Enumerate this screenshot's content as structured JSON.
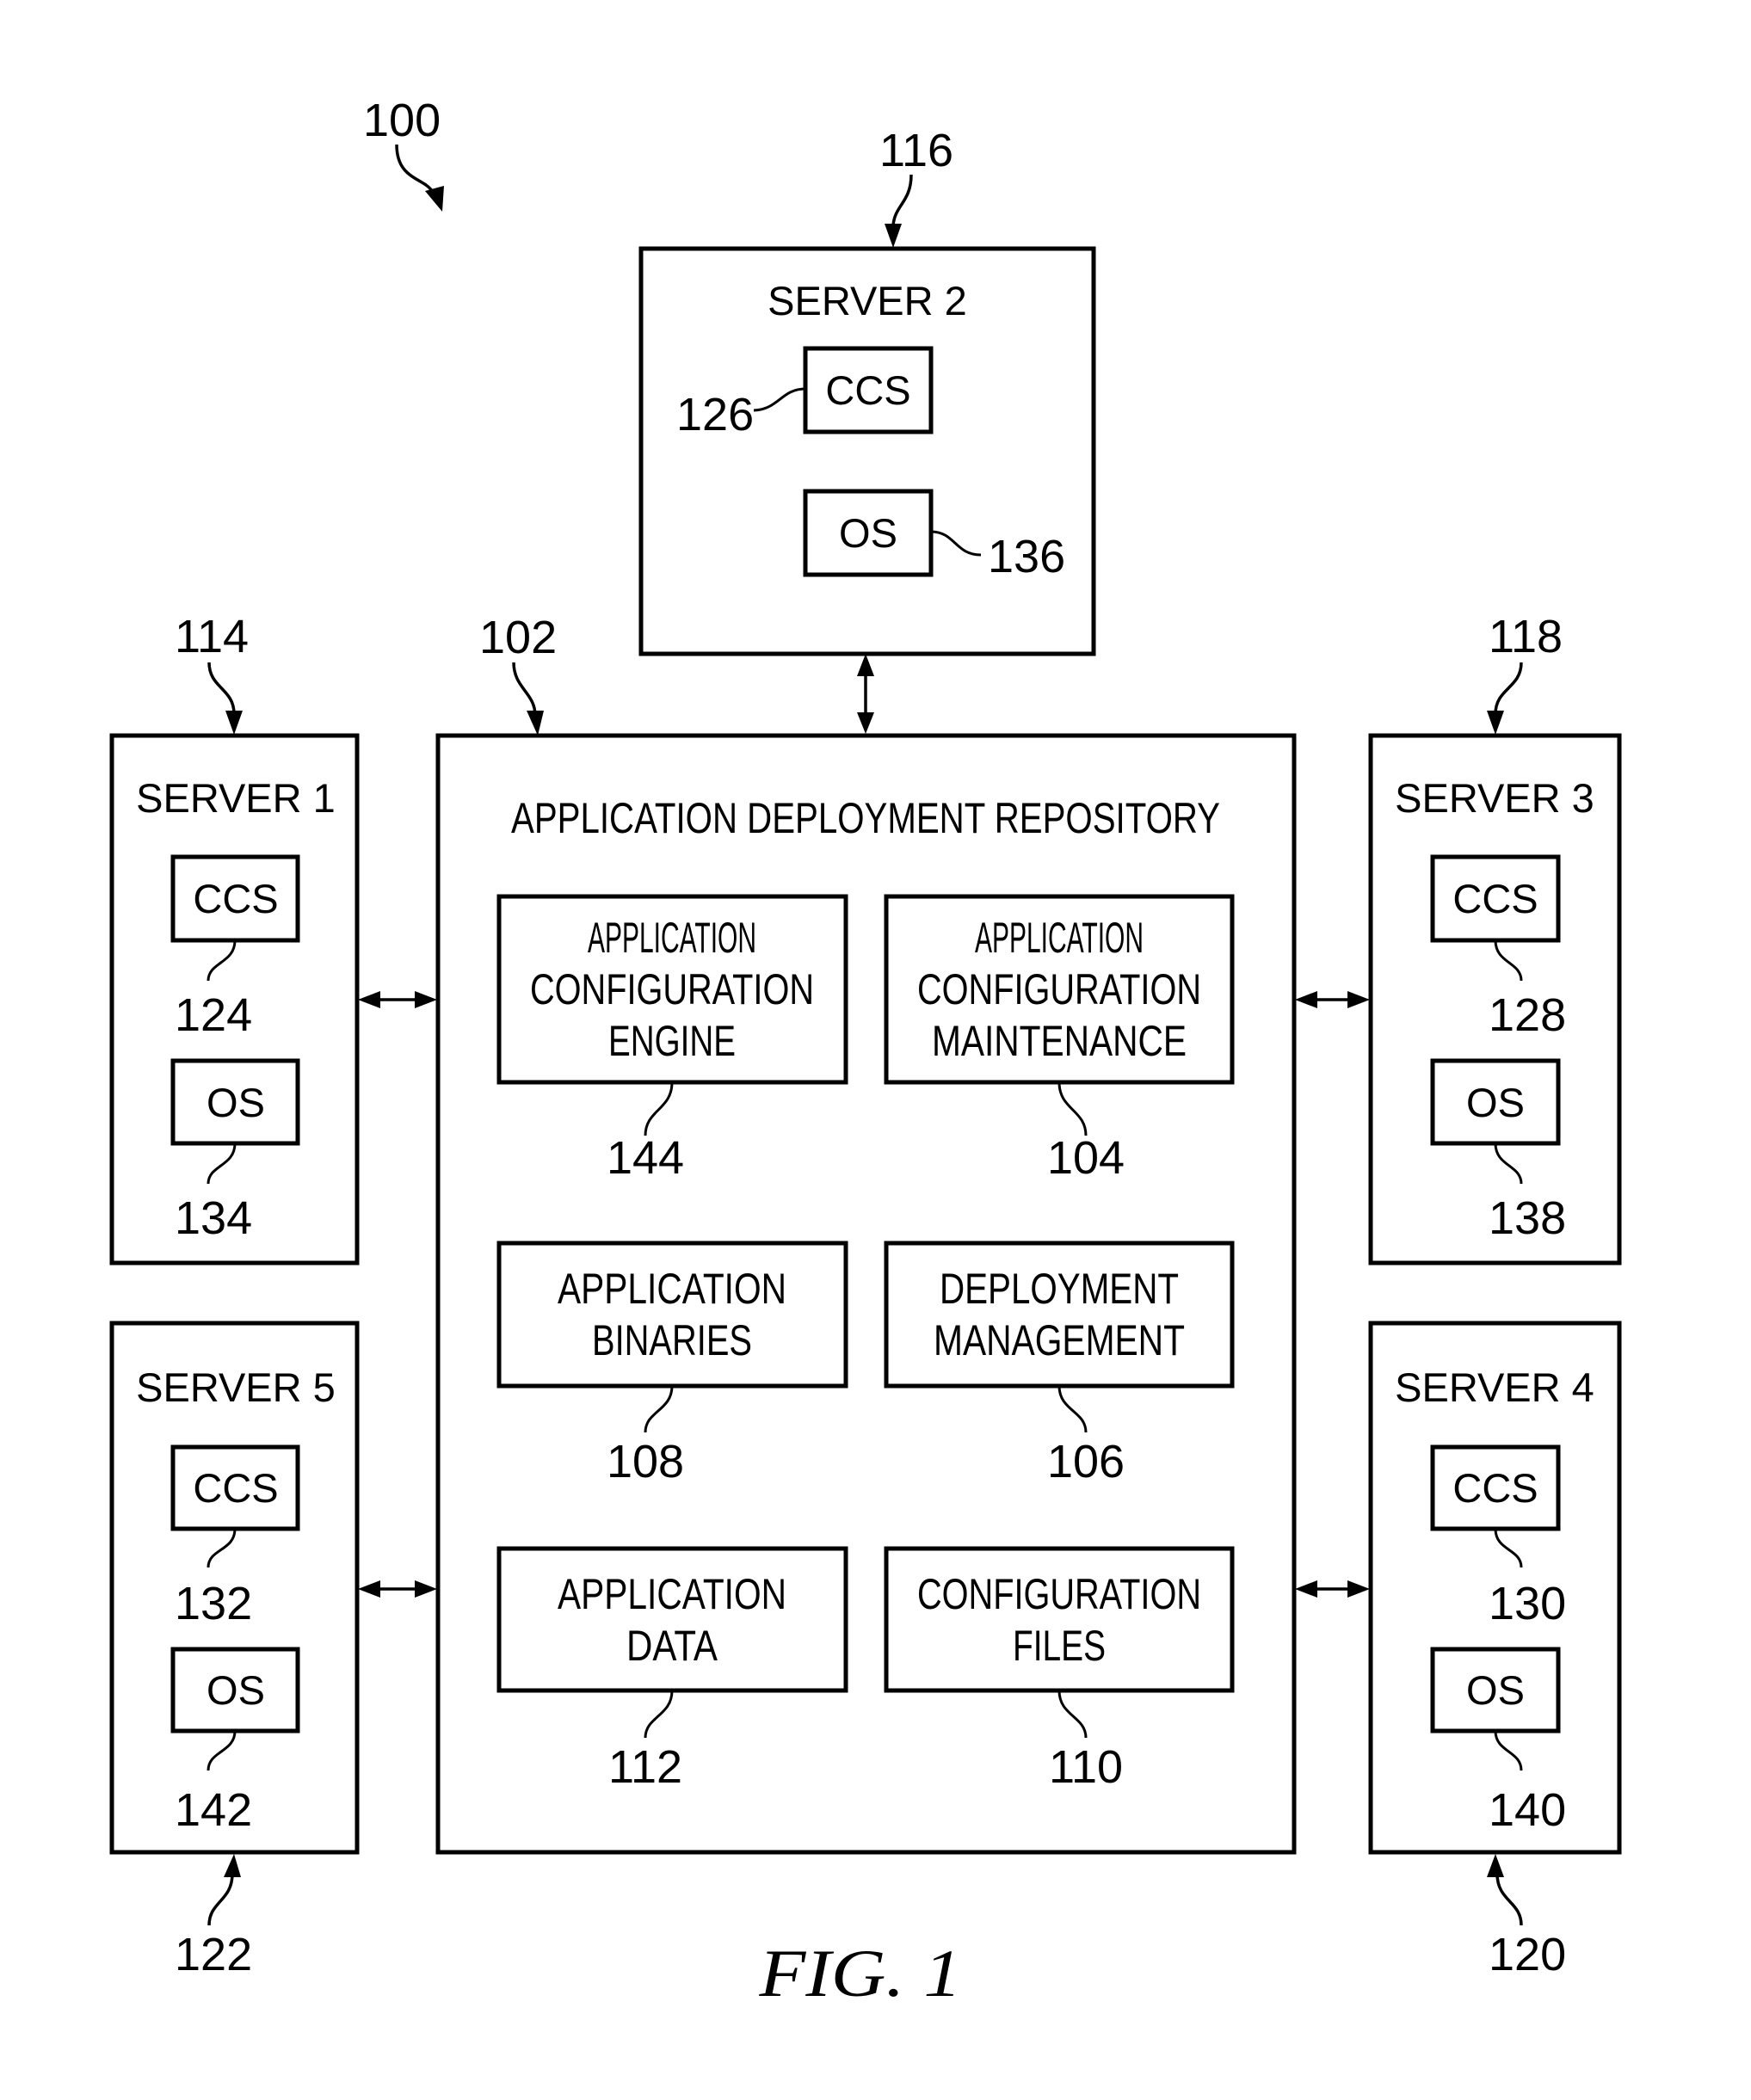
{
  "figure": {
    "caption": "FIG. 1",
    "system_ref": "100"
  },
  "repository": {
    "ref": "102",
    "title": "APPLICATION DEPLOYMENT REPOSITORY",
    "components": [
      {
        "ref": "144",
        "lines": [
          "APPLICATION",
          "CONFIGURATION",
          "ENGINE"
        ]
      },
      {
        "ref": "104",
        "lines": [
          "APPLICATION",
          "CONFIGURATION",
          "MAINTENANCE"
        ]
      },
      {
        "ref": "108",
        "lines": [
          "APPLICATION",
          "BINARIES"
        ]
      },
      {
        "ref": "106",
        "lines": [
          "DEPLOYMENT",
          "MANAGEMENT"
        ]
      },
      {
        "ref": "112",
        "lines": [
          "APPLICATION",
          "DATA"
        ]
      },
      {
        "ref": "110",
        "lines": [
          "CONFIGURATION",
          "FILES"
        ]
      }
    ]
  },
  "servers": [
    {
      "id": "server1",
      "title": "SERVER 1",
      "ref": "114",
      "ccs_label": "CCS",
      "ccs_ref": "124",
      "os_label": "OS",
      "os_ref": "134"
    },
    {
      "id": "server2",
      "title": "SERVER 2",
      "ref": "116",
      "ccs_label": "CCS",
      "ccs_ref": "126",
      "os_label": "OS",
      "os_ref": "136"
    },
    {
      "id": "server3",
      "title": "SERVER 3",
      "ref": "118",
      "ccs_label": "CCS",
      "ccs_ref": "128",
      "os_label": "OS",
      "os_ref": "138"
    },
    {
      "id": "server4",
      "title": "SERVER 4",
      "ref": "120",
      "ccs_label": "CCS",
      "ccs_ref": "130",
      "os_label": "OS",
      "os_ref": "140"
    },
    {
      "id": "server5",
      "title": "SERVER 5",
      "ref": "122",
      "ccs_label": "CCS",
      "ccs_ref": "132",
      "os_label": "OS",
      "os_ref": "142"
    }
  ],
  "connections": [
    {
      "from": "SERVER 1",
      "to": "APPLICATION DEPLOYMENT REPOSITORY",
      "type": "bidirectional"
    },
    {
      "from": "SERVER 2",
      "to": "APPLICATION DEPLOYMENT REPOSITORY",
      "type": "bidirectional"
    },
    {
      "from": "SERVER 3",
      "to": "APPLICATION DEPLOYMENT REPOSITORY",
      "type": "bidirectional"
    },
    {
      "from": "SERVER 4",
      "to": "APPLICATION DEPLOYMENT REPOSITORY",
      "type": "bidirectional"
    },
    {
      "from": "SERVER 5",
      "to": "APPLICATION DEPLOYMENT REPOSITORY",
      "type": "bidirectional"
    }
  ]
}
